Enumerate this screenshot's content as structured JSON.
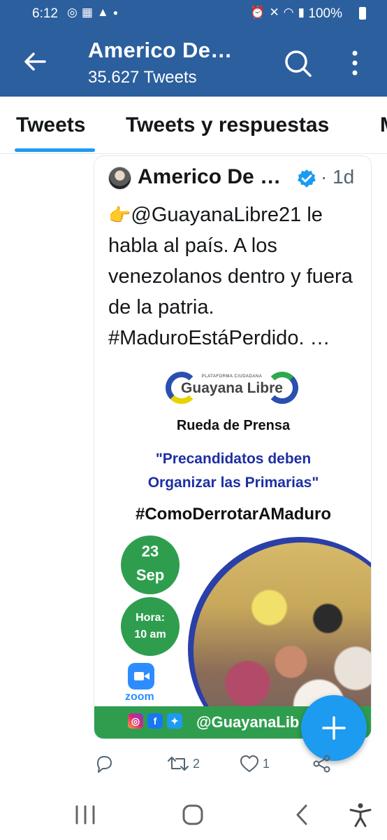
{
  "status_bar": {
    "time": "6:12",
    "battery": "100%",
    "left_icons": [
      "whatsapp-icon",
      "image-icon",
      "warning-icon",
      "dot-icon"
    ],
    "right_icons": [
      "alarm-icon",
      "mute-icon",
      "wifi-icon",
      "signal-icon",
      "signal-icon",
      "battery-icon"
    ]
  },
  "header": {
    "title": "Americo De…",
    "subtitle": "35.627 Tweets",
    "bg_color": "#2c5f9e"
  },
  "tabs": [
    {
      "label": "Tweets",
      "active": true
    },
    {
      "label": "Tweets y respuestas",
      "active": false
    },
    {
      "label": "M",
      "active": false
    }
  ],
  "tweet": {
    "author": "Americo De …",
    "time": "· 1d",
    "emoji": "👉",
    "text": "@GuayanaLibre21 le habla al país. A los venezolanos dentro y fuera de la patria. #MaduroEstáPerdido. …",
    "media": {
      "logo_small": "PLATAFORMA CIUDADANA",
      "logo_text": "Guayana Libre",
      "heading": "Rueda de Prensa",
      "quote_line1": "\"Precandidatos deben",
      "quote_line2": "Organizar las Primarias\"",
      "hashtag": "#ComoDerrotarAMaduro",
      "day": "23",
      "month": "Sep",
      "hour_label": "Hora:",
      "hour_value": "10 am",
      "zoom_label": "zoom",
      "handle": "@GuayanaLib"
    },
    "actions": {
      "reply_count": "",
      "retweet_count": "2",
      "like_count": "1"
    }
  },
  "accent_color": "#1d9bf0"
}
